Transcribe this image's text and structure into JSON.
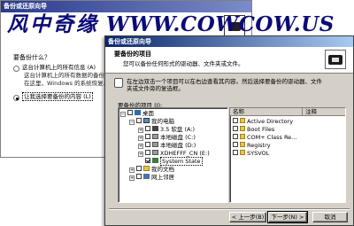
{
  "back_window": {
    "title": "备份或还原向导",
    "question": "要备份什么？",
    "option1": "这台计算机上的所有信息 (A)",
    "option1_desc1": "这台计算机上的所有数据的备份，",
    "option1_desc2": "在这里，Windows 的系统恢复...",
    "option2": "让我选择要备份的内容 (L)"
  },
  "watermark": {
    "chinese": "风中奇缘",
    "url": "WWW.COWCOW.US"
  },
  "dialog": {
    "title": "备份或还原向导",
    "header_title": "要备份的项目",
    "header_subtitle": "您可以备份任何形式的驱动器、文件夹或文件。",
    "instruction_line1": "在左边双击一个项目可以在右边查看其内容。然后选择要备份的驱动器、文件",
    "instruction_line2": "夹或文件旁的复选框。",
    "tree_label": "要备份的项目 (I):",
    "tree": [
      {
        "label": "桌面",
        "expander": "−",
        "icon": "desktop",
        "checked": false
      },
      {
        "label": "我的电脑",
        "expander": "−",
        "icon": "computer",
        "checked": false
      },
      {
        "label": "3.5 软盘 (A:)",
        "expander": "+",
        "icon": "floppy",
        "checked": false
      },
      {
        "label": "本地磁盘 (C:)",
        "expander": "+",
        "icon": "drive",
        "checked": false
      },
      {
        "label": "本地磁盘 (D:)",
        "expander": "+",
        "icon": "drive",
        "checked": false
      },
      {
        "label": "XDHEFFF_CN (E:)",
        "expander": "+",
        "icon": "drive",
        "checked": false
      },
      {
        "label": "System State",
        "expander": "",
        "icon": "system",
        "checked": true
      },
      {
        "label": "我的文档",
        "expander": "+",
        "icon": "folder",
        "checked": false
      },
      {
        "label": "网上邻居",
        "expander": "+",
        "icon": "network",
        "checked": false
      }
    ],
    "list_columns": {
      "name": "名称",
      "comment": "注释"
    },
    "list_items": [
      {
        "label": "Active Directory"
      },
      {
        "label": "Boot Files"
      },
      {
        "label": "COM+ Class Re..."
      },
      {
        "label": "Registry"
      },
      {
        "label": "SYSVOL"
      }
    ],
    "buttons": {
      "back": "< 上一步(B)",
      "next": "下一步(N) >",
      "cancel": "取消"
    }
  }
}
